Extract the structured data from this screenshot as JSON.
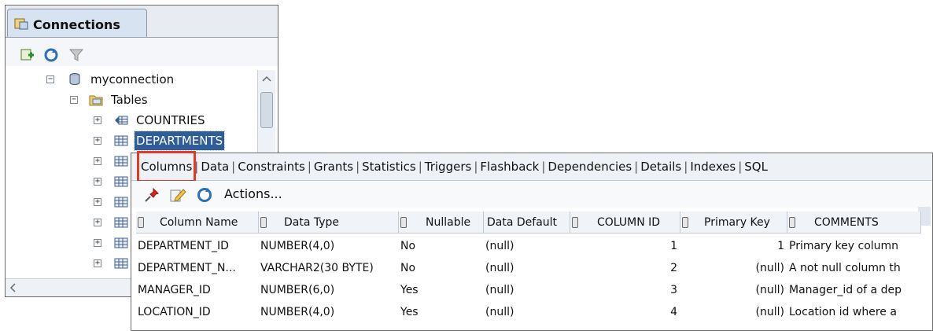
{
  "connections_panel": {
    "tab_label": "Connections",
    "tree": {
      "connection": "myconnection",
      "folder": "Tables",
      "tables": [
        "COUNTRIES",
        "DEPARTMENTS"
      ]
    }
  },
  "editor": {
    "tabs": [
      "Columns",
      "Data",
      "Constraints",
      "Grants",
      "Statistics",
      "Triggers",
      "Flashback",
      "Dependencies",
      "Details",
      "Indexes",
      "SQL"
    ],
    "tab_separator": "|",
    "active_tab": "Columns",
    "toolbar": {
      "actions_label": "Actions..."
    },
    "columns": [
      "Column Name",
      "Data Type",
      "Nullable",
      "Data Default",
      "COLUMN ID",
      "Primary Key",
      "COMMENTS"
    ],
    "rows": [
      [
        "DEPARTMENT_ID",
        "NUMBER(4,0)",
        "No",
        "(null)",
        "1",
        "1",
        "Primary key column"
      ],
      [
        "DEPARTMENT_N...",
        "VARCHAR2(30 BYTE)",
        "No",
        "(null)",
        "2",
        "(null)",
        "A not null column th"
      ],
      [
        "MANAGER_ID",
        "NUMBER(6,0)",
        "Yes",
        "(null)",
        "3",
        "(null)",
        "Manager_id of a dep"
      ],
      [
        "LOCATION_ID",
        "NUMBER(4,0)",
        "Yes",
        "(null)",
        "4",
        "(null)",
        "Location id where a"
      ]
    ]
  },
  "colors": {
    "selection": "#2f5d9a",
    "active_tab_highlight": "#e23a24"
  }
}
